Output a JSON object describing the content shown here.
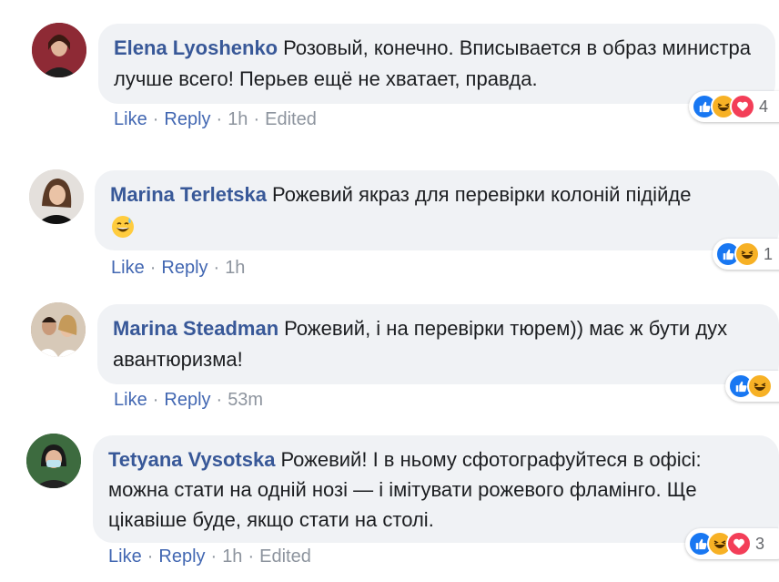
{
  "comments": [
    {
      "author": "Elena Lyoshenko",
      "text": "Розовый, конечно. Вписывается в образ министра лучше всего! Перьев ещё не хватает, правда.",
      "actions": {
        "like": "Like",
        "reply": "Reply",
        "time": "1h",
        "edited": "Edited"
      },
      "reactions": [
        "like",
        "haha",
        "love"
      ],
      "reaction_count": "4"
    },
    {
      "author": "Marina Terletska",
      "text": "Рожевий якраз для перевірки колоній підійде",
      "emoji": "grinning-sweat-emoji",
      "actions": {
        "like": "Like",
        "reply": "Reply",
        "time": "1h"
      },
      "reactions": [
        "like",
        "haha"
      ],
      "reaction_count": "1"
    },
    {
      "author": "Marina Steadman",
      "text": "Рожевий, і на перевірки тюрем)) має ж бути дух авантюризма!",
      "actions": {
        "like": "Like",
        "reply": "Reply",
        "time": "53m"
      },
      "reactions": [
        "like",
        "haha"
      ],
      "reaction_count": ""
    },
    {
      "author": "Tetyana Vysotska",
      "text": "Рожевий! І в ньому сфотографуйтеся в офісі: можна стати на одній нозі — і імітувати рожевого фламінго. Ще цікавіше буде, якщо стати на столі.",
      "actions": {
        "like": "Like",
        "reply": "Reply",
        "time": "1h",
        "edited": "Edited"
      },
      "reactions": [
        "like",
        "haha",
        "love"
      ],
      "reaction_count": "3"
    }
  ],
  "colors": {
    "author": "#385898",
    "link": "#4267b2",
    "meta": "#8d949e",
    "bubble": "#f0f2f5",
    "like": "#1877f2",
    "haha": "#f7b125",
    "love": "#f33e58"
  }
}
